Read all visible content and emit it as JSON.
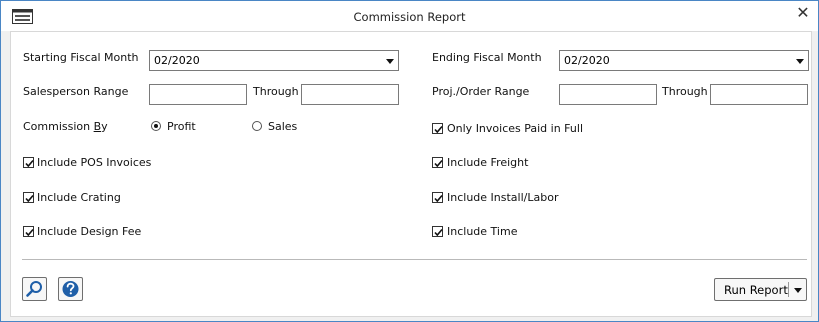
{
  "window": {
    "title": "Commission Report",
    "close_glyph": "✕"
  },
  "icons": {
    "app": "report-window-icon",
    "close": "close-icon",
    "search": "magnifier-icon",
    "help": "help-icon"
  },
  "fields": {
    "starting_fiscal_month": {
      "label": "Starting Fiscal Month",
      "value": "02/2020"
    },
    "ending_fiscal_month": {
      "label": "Ending Fiscal Month",
      "value": "02/2020"
    },
    "salesperson_range": {
      "label": "Salesperson Range",
      "from": "",
      "through_label": "Through",
      "to": ""
    },
    "proj_order_range": {
      "label": "Proj./Order Range",
      "from": "",
      "through_label": "Through",
      "to": ""
    }
  },
  "commission_by": {
    "label_pre": "Commission ",
    "label_accel": "B",
    "label_post": "y",
    "options": [
      {
        "label": "Profit",
        "selected": true
      },
      {
        "label": "Sales",
        "selected": false
      }
    ]
  },
  "checkboxes": {
    "only_invoices_paid": {
      "label": "Only Invoices Paid in Full",
      "checked": true
    },
    "include_pos_invoices": {
      "label": "Include POS Invoices",
      "checked": true
    },
    "include_freight": {
      "label": "Include Freight",
      "checked": true
    },
    "include_crating": {
      "label": "Include Crating",
      "checked": true
    },
    "include_install_labor": {
      "label": "Include Install/Labor",
      "checked": true
    },
    "include_design_fee": {
      "label": "Include Design Fee",
      "checked": true
    },
    "include_time": {
      "label": "Include Time",
      "checked": true
    }
  },
  "buttons": {
    "run_report": "Run Report"
  },
  "colors": {
    "accent": "#1f5fa8",
    "window_border": "#4a86c5",
    "background": "#f0f0f0"
  }
}
